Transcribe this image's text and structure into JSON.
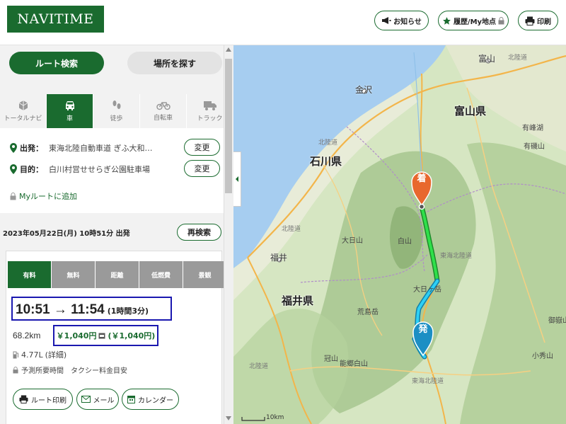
{
  "header": {
    "logo": "NAVITIME",
    "notice_label": "お知らせ",
    "history_label": "履歴/My地点",
    "print_label": "印刷"
  },
  "search_tabs": {
    "route_label": "ルート検索",
    "place_label": "場所を探す"
  },
  "modes": [
    {
      "label": "トータルナビ",
      "icon": "total-navi-icon",
      "active": false
    },
    {
      "label": "車",
      "icon": "car-icon",
      "active": true
    },
    {
      "label": "徒歩",
      "icon": "walk-icon",
      "active": false
    },
    {
      "label": "自転車",
      "icon": "bicycle-icon",
      "active": false
    },
    {
      "label": "トラック",
      "icon": "truck-icon",
      "active": false
    }
  ],
  "endpoints": {
    "departure_label": "出発：",
    "departure_value": "東海北陸自動車道 ぎふ大和…",
    "destination_label": "目的：",
    "destination_value": "白川村営せせらぎ公園駐車場",
    "change_label": "変更",
    "myroute_label": "Myルートに追加"
  },
  "search_time": {
    "text": "2023年05月22日(月) 10時51分 出発",
    "research_label": "再検索"
  },
  "route_tabs": [
    "有料",
    "無料",
    "距離",
    "低燃費",
    "景観"
  ],
  "route": {
    "time_range": "10:51 → 11:54",
    "duration": "(1時間3分)",
    "distance": "68.2km",
    "fare": "￥1,040円",
    "etc_fare": "(￥1,040円)",
    "fuel": "4.77L",
    "fuel_detail": "(詳細)",
    "note": "予測所要時間　タクシー料金目安",
    "print_label": "ルート印刷",
    "mail_label": "メール",
    "calendar_label": "カレンダー"
  },
  "map": {
    "prefectures": [
      "富山県",
      "石川県",
      "福井県"
    ],
    "cities": [
      "富山",
      "金沢",
      "福井"
    ],
    "places": [
      "白山",
      "大日山",
      "大日ヶ岳",
      "荒島岳",
      "冠山",
      "能郷白山",
      "小秀山",
      "御嶽山",
      "有峰湖",
      "有磯山"
    ],
    "roads": [
      "北陸道",
      "北陸道",
      "北陸道",
      "東海北陸道",
      "東海北陸道",
      "北陸道"
    ],
    "dest_marker": "着",
    "origin_marker": "発",
    "scale": "10km",
    "colors": {
      "route_green": "#22c93a",
      "route_cyan": "#1ec0e8",
      "dest_marker": "#e8682d",
      "origin_marker": "#1c8fc4"
    }
  }
}
